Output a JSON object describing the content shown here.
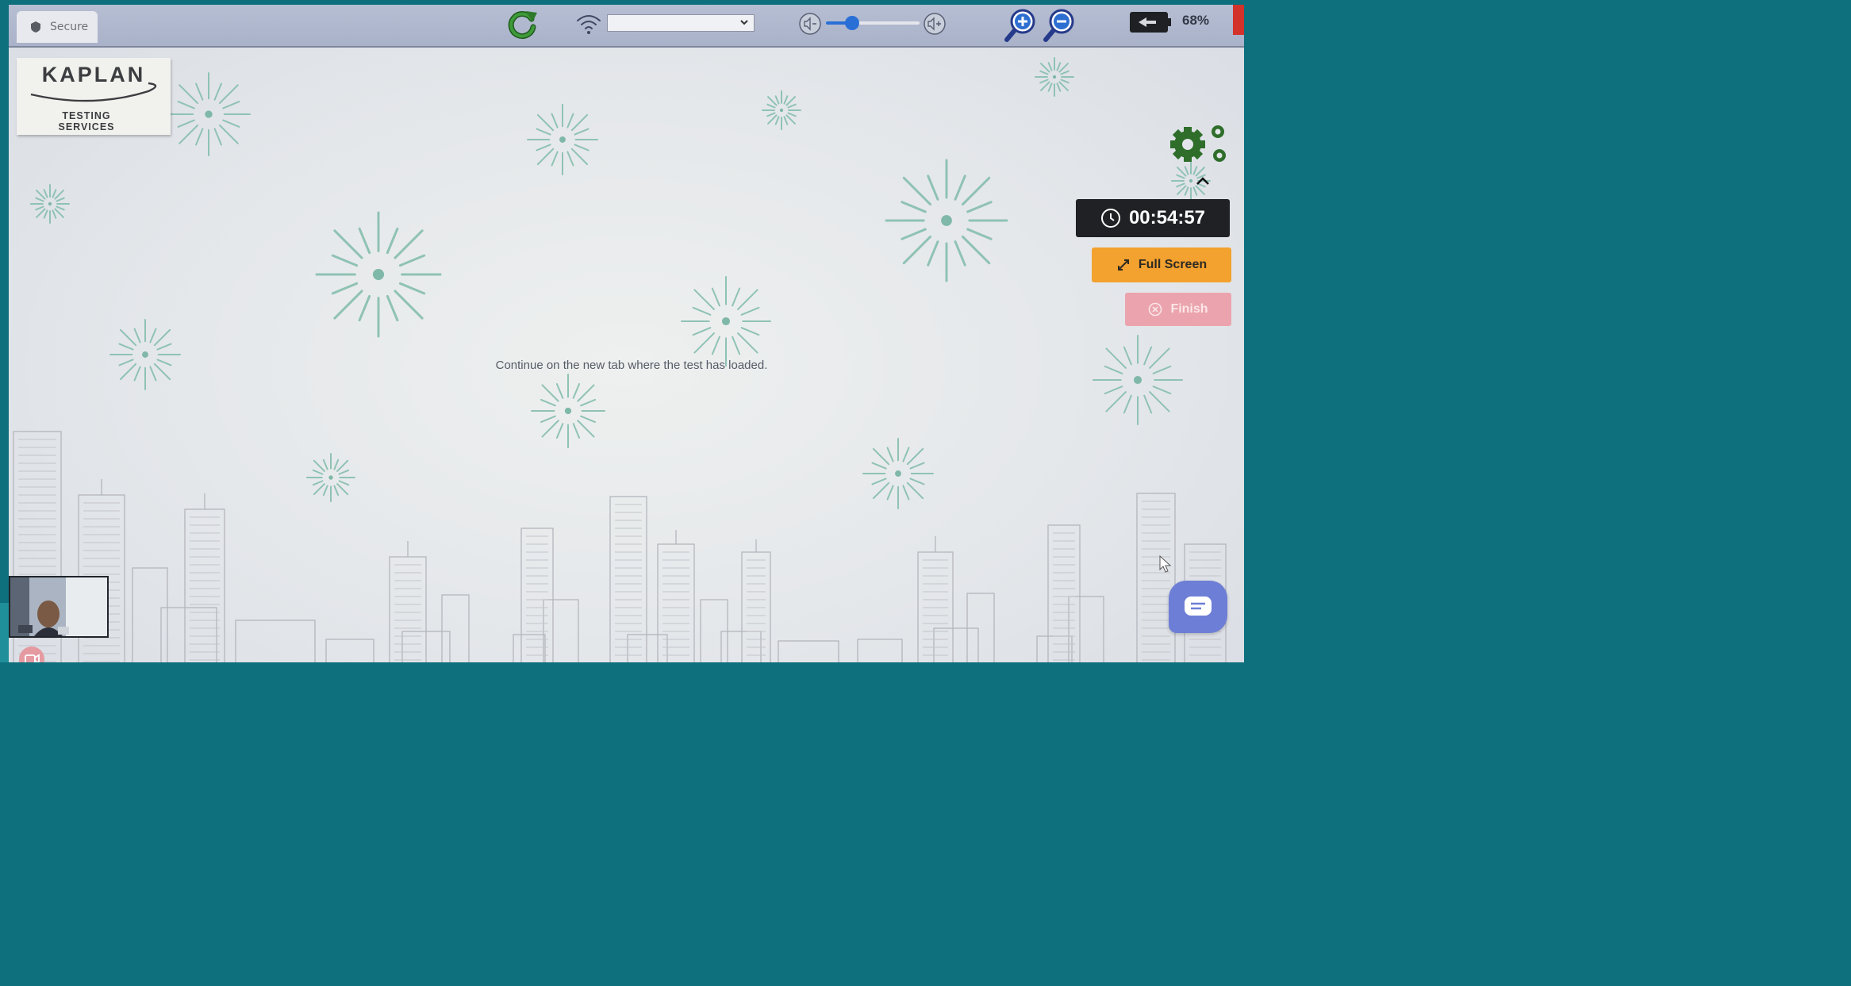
{
  "topbar": {
    "secure_label": "Secure",
    "volume_level": 0.28,
    "battery_percent": "68%"
  },
  "logo": {
    "brand": "KAPLAN",
    "subtitle_line1": "TESTING",
    "subtitle_line2": "SERVICES"
  },
  "main": {
    "message": "Continue on the new tab where the test has loaded."
  },
  "side_panel": {
    "timer": "00:54:57",
    "fullscreen_label": "Full Screen",
    "finish_label": "Finish"
  },
  "colors": {
    "fullscreen_bg": "#f3a12f",
    "finish_bg": "#eba4ad",
    "timer_bg": "#1f2124",
    "accent_green": "#2e6e2a",
    "chat_bg": "#6d7ed6"
  },
  "icons": [
    "shield-icon",
    "refresh-icon",
    "wifi-icon",
    "volume-down-icon",
    "volume-up-icon",
    "zoom-in-icon",
    "zoom-out-icon",
    "battery-icon",
    "gears-icon",
    "chevron-up-icon",
    "clock-icon",
    "expand-icon",
    "close-circle-icon",
    "chat-icon",
    "webcam-icon"
  ]
}
